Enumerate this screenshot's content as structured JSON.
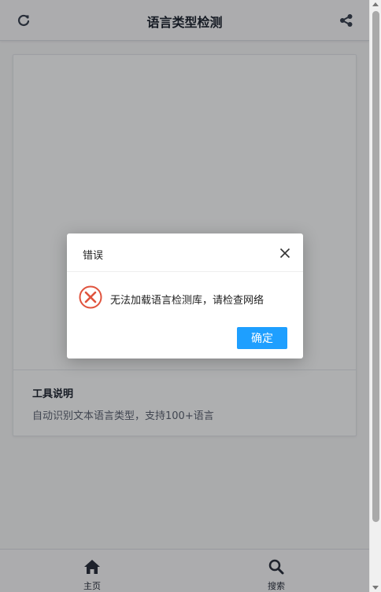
{
  "header": {
    "title": "语言类型检测",
    "refresh_icon": "refresh-icon",
    "share_icon": "share-icon"
  },
  "card": {
    "info_title": "工具说明",
    "info_desc": "自动识别文本语言类型，支持100+语言"
  },
  "bottom_nav": {
    "items": [
      {
        "label": "主页",
        "icon": "home-icon"
      },
      {
        "label": "搜索",
        "icon": "search-icon"
      }
    ]
  },
  "dialog": {
    "title": "错误",
    "message": "无法加载语言检测库，请检查网络",
    "confirm_label": "确定",
    "icon": "error-circle-icon",
    "close_icon": "close-icon"
  },
  "colors": {
    "accent": "#1e9fff",
    "error": "#e0533d",
    "text": "#1f2633"
  }
}
